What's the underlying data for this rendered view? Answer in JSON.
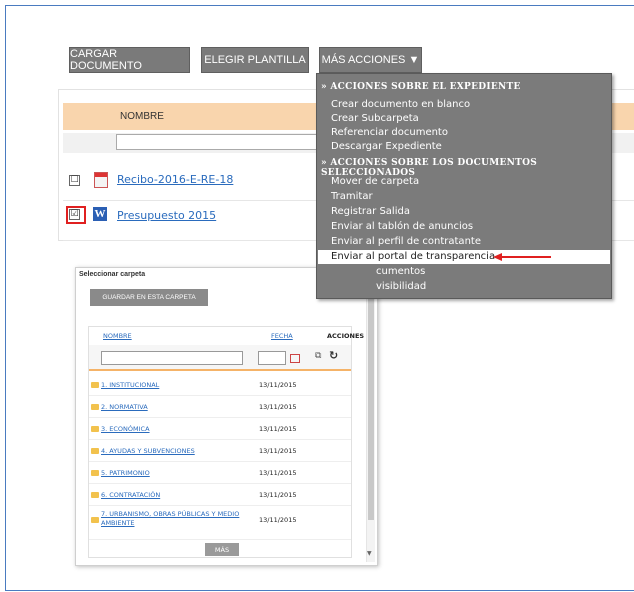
{
  "toolbar": {
    "upload_label": "CARGAR DOCUMENTO",
    "template_label": "ELEGIR PLANTILLA",
    "more_label": "MÁS ACCIONES ▼"
  },
  "table": {
    "column_name": "NOMBRE",
    "rows": [
      {
        "name": "Recibo-2016-E-RE-18",
        "checked": "☐",
        "icon": "pdf-icon"
      },
      {
        "name": "Presupuesto 2015",
        "checked": "☑",
        "icon": "word-icon"
      }
    ]
  },
  "menu": {
    "section1": "» ACCIONES SOBRE EL EXPEDIENTE",
    "items1": [
      "Crear documento en blanco",
      "Crear Subcarpeta",
      "Referenciar documento",
      "Descargar Expediente"
    ],
    "section2": "» ACCIONES SOBRE LOS DOCUMENTOS SELECCIONADOS",
    "items2": [
      "Mover de carpeta",
      "Tramitar",
      "Registrar Salida",
      "Enviar al tablón de anuncios",
      "Enviar al perfil de contratante"
    ],
    "highlighted": "Enviar al portal de transparencia",
    "items3": [
      "cumentos",
      "visibilidad"
    ]
  },
  "dialog": {
    "title": "Seleccionar carpeta",
    "close": "×",
    "save_label": "GUARDAR EN ESTA CARPETA",
    "col_name": "NOMBRE",
    "col_date": "FECHA",
    "col_actions": "ACCIONES",
    "more_label": "MÁS",
    "folders": [
      {
        "name": "1. INSTITUCIONAL",
        "date": "13/11/2015"
      },
      {
        "name": "2. NORMATIVA",
        "date": "13/11/2015"
      },
      {
        "name": "3. ECONÓMICA",
        "date": "13/11/2015"
      },
      {
        "name": "4. AYUDAS Y SUBVENCIONES",
        "date": "13/11/2015"
      },
      {
        "name": "5. PATRIMONIO",
        "date": "13/11/2015"
      },
      {
        "name": "6. CONTRATACIÓN",
        "date": "13/11/2015"
      },
      {
        "name": "7. URBANISMO, OBRAS PÚBLICAS Y MEDIO",
        "name2": "AMBIENTE",
        "date": "13/11/2015"
      }
    ]
  },
  "colors": {
    "accent_red": "#e02020",
    "header_orange": "#f9d5ad",
    "link_blue": "#2a6bbd",
    "menu_gray": "#7b7b7b"
  }
}
